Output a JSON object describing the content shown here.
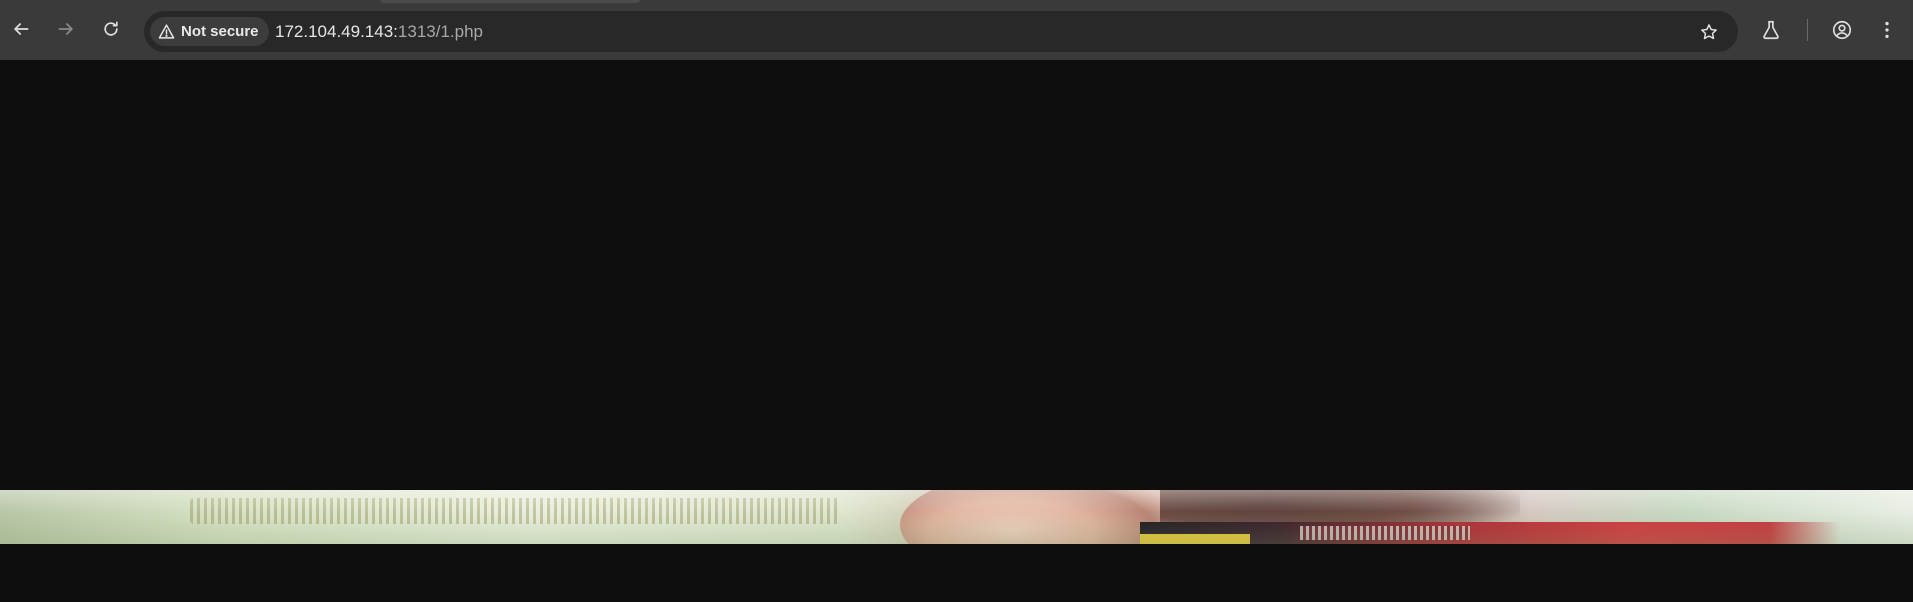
{
  "browser": {
    "security_label": "Not secure",
    "url_host": "172.104.49.143:",
    "url_path": "1313/1.php",
    "icons": {
      "back": "arrow-left-icon",
      "forward": "arrow-right-icon",
      "reload": "reload-icon",
      "security": "warning-triangle-icon",
      "bookmark": "star-icon",
      "labs": "flask-icon",
      "profile": "account-circle-icon",
      "menu": "kebab-menu-icon"
    }
  },
  "page": {
    "banner": {
      "description_icon": "photo-banner"
    }
  }
}
